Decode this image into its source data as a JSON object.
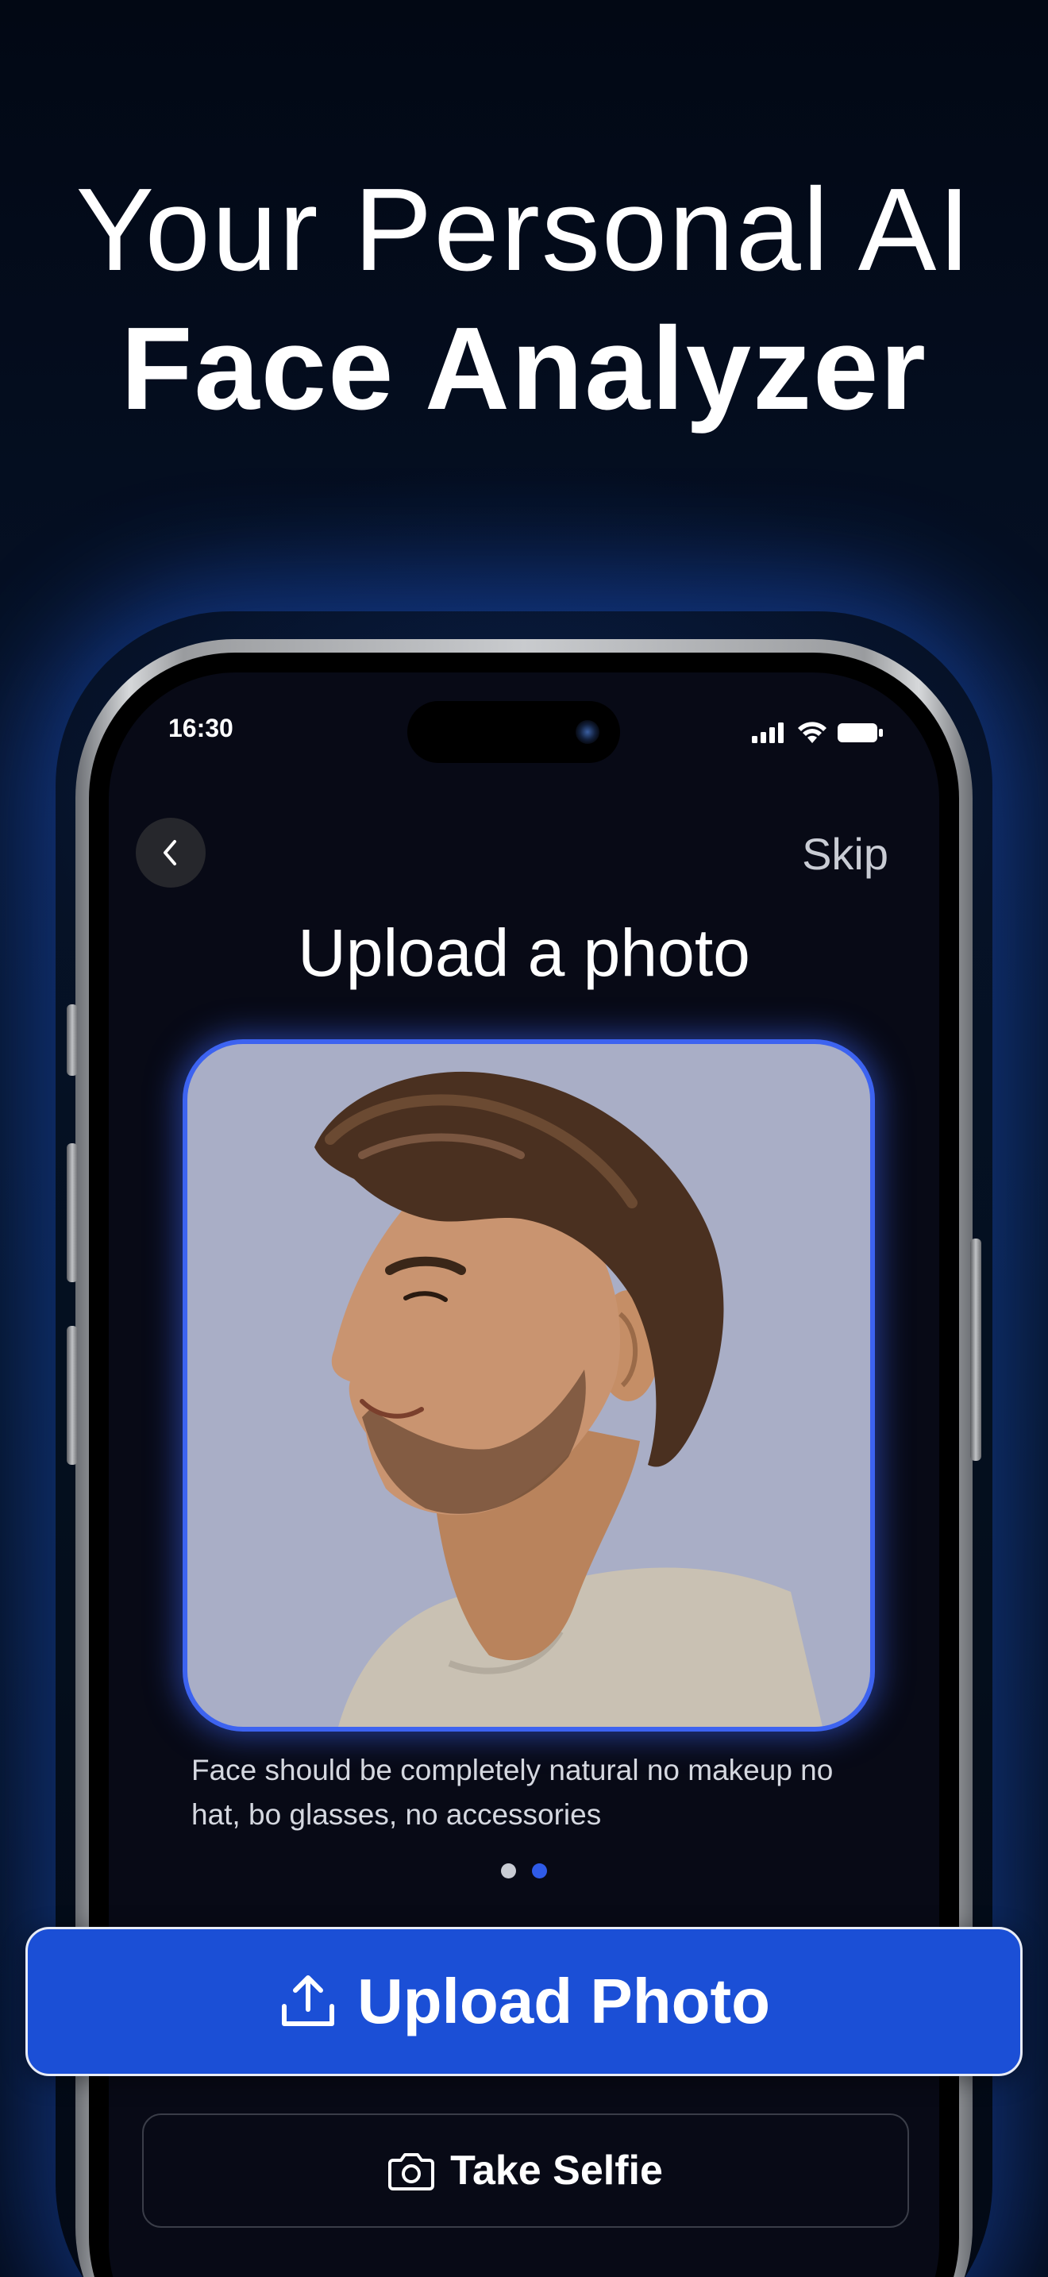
{
  "headline": {
    "line1": "Your Personal AI",
    "line2": "Face Analyzer"
  },
  "status_bar": {
    "time": "16:30",
    "icons": [
      "cellular-signal-icon",
      "wifi-icon",
      "battery-icon"
    ]
  },
  "nav": {
    "back_icon": "chevron-left-icon",
    "skip_label": "Skip"
  },
  "screen": {
    "title": "Upload a photo",
    "photo_description": "Side profile of a smiling man with brown hair and beard",
    "instruction": "Face should be completely natural no makeup no hat, bo glasses, no accessories",
    "pager": {
      "total": 2,
      "active_index": 1
    }
  },
  "buttons": {
    "upload_label": "Upload Photo",
    "upload_icon": "upload-icon",
    "selfie_label": "Take Selfie",
    "selfie_icon": "camera-icon"
  },
  "colors": {
    "accent": "#1b4fd6",
    "photo_border": "#3d63f0",
    "pager_active": "#2f5be8",
    "pager_inactive": "#c9ccd4",
    "photo_background": "#a9aec6"
  }
}
